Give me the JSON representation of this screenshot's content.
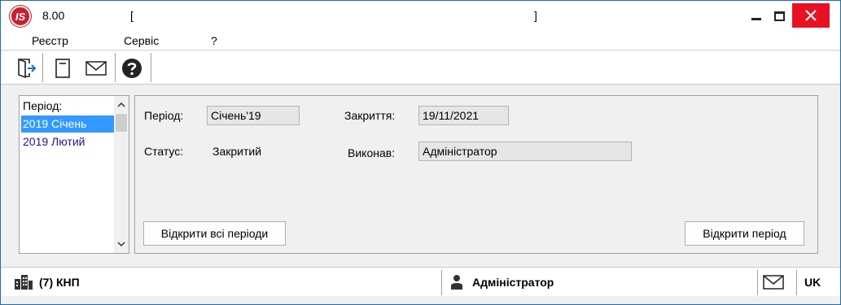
{
  "window": {
    "version": "8.00",
    "bracket_left": "[",
    "bracket_right": "]",
    "logo_text": "IS"
  },
  "menu": {
    "items": [
      "Реєстр",
      "Сервіс",
      "?"
    ]
  },
  "toolbar": {
    "icons": [
      "exit-icon",
      "document-icon",
      "envelope-icon",
      "help-icon"
    ]
  },
  "period_list": {
    "header": "Період:",
    "items": [
      {
        "label": "2019 Січень",
        "selected": true
      },
      {
        "label": "2019 Лютий",
        "selected": false
      }
    ]
  },
  "details": {
    "period_label": "Період:",
    "period_value": "Січень'19",
    "closing_label": "Закриття:",
    "closing_value": "19/11/2021",
    "status_label": "Статус:",
    "status_value": "Закритий",
    "executor_label": "Виконав:",
    "executor_value": "Адміністратор",
    "open_all_button": "Відкрити всі періоди",
    "open_period_button": "Відкрити період"
  },
  "statusbar": {
    "organization": "(7) КНП",
    "user": "Адміністратор",
    "language": "UK"
  },
  "colors": {
    "selection": "#3399ff",
    "close_button": "#e81123",
    "logo": "#c8202c"
  }
}
